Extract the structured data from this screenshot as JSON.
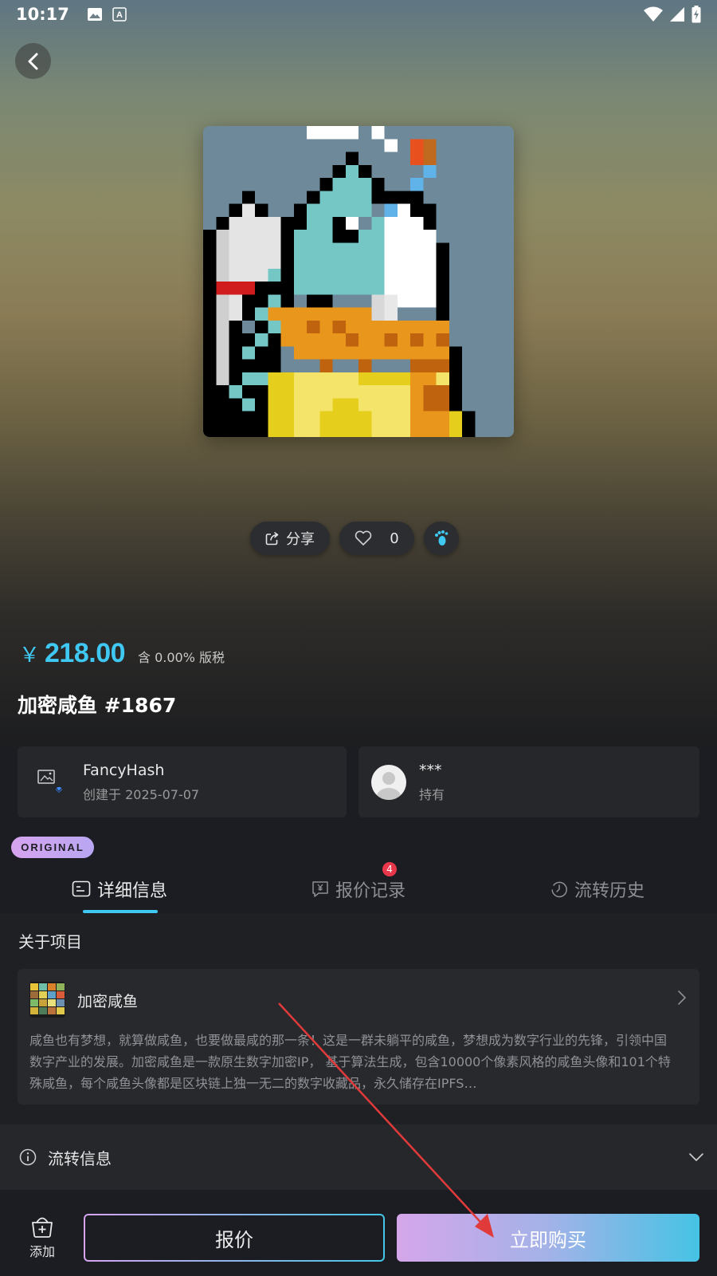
{
  "status_bar": {
    "time": "10:17"
  },
  "item": {
    "currency": "￥",
    "price": "218.00",
    "tax_note": "含 0.00% 版税",
    "title": "加密咸鱼 #1867"
  },
  "actions": {
    "share": "分享",
    "likes": "0"
  },
  "creator": {
    "name": "FancyHash",
    "created": "创建于 2025-07-07"
  },
  "owner": {
    "name": "***",
    "status": "持有"
  },
  "badge": "ORIGINAL",
  "tabs": [
    {
      "label": "详细信息",
      "active": true
    },
    {
      "label": "报价记录",
      "badge": "4"
    },
    {
      "label": "流转历史"
    }
  ],
  "about": {
    "section_title": "关于项目",
    "project_name": "加密咸鱼",
    "description": "咸鱼也有梦想，就算做咸鱼，也要做最咸的那一条！这是一群未躺平的咸鱼，梦想成为数字行业的先锋，引领中国数字产业的发展。加密咸鱼是一款原生数字加密IP， 基于算法生成，包含10000个像素风格的咸鱼头像和101个特殊咸鱼，每个咸鱼头像都是区块链上独一无二的数字收藏品，永久储存在IPFS…"
  },
  "circulation": {
    "label": "流转信息"
  },
  "bottom": {
    "add_label": "添加",
    "offer_label": "报价",
    "buy_label": "立即购买"
  },
  "colors": {
    "accent": "#3fc8f2",
    "badge_red": "#e8374a",
    "buy_gradient_start": "#d5a6ea",
    "buy_gradient_end": "#46c3e4"
  }
}
